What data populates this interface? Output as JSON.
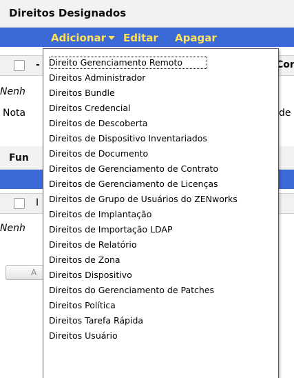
{
  "panel1": {
    "title": "Direitos Designados",
    "actions": {
      "add": "Adicionar",
      "edit": "Editar",
      "delete": "Apagar"
    },
    "header_left_partial": "-",
    "header_right_partial": "Con",
    "empty_partial": "Nenh",
    "note_partial_left": "Nota",
    "note_partial_right": "de"
  },
  "panel2": {
    "title_partial": "Fun",
    "header_partial": "I",
    "empty_partial": "Nenh",
    "button_partial": "A"
  },
  "menu": {
    "items": [
      "Direito Gerenciamento Remoto",
      "Direitos Administrador",
      "Direitos Bundle",
      "Direitos Credencial",
      "Direitos de Descoberta",
      "Direitos de Dispositivo Inventariados",
      "Direitos de Documento",
      "Direitos de Gerenciamento de Contrato",
      "Direitos de Gerenciamento de Licenças",
      "Direitos de Grupo de Usuários do ZENworks",
      "Direitos de Implantação",
      "Direitos de Importação LDAP",
      "Direitos de Relatório",
      "Direitos de Zona",
      "Direitos Dispositivo",
      "Direitos do Gerenciamento de Patches",
      "Direitos Política",
      "Direitos Tarefa Rápida",
      "Direitos Usuário"
    ]
  },
  "colors": {
    "action_bar": "#3b6ad7",
    "action_link": "#ffe25a",
    "panel_header_bg": "#f2f2f2"
  }
}
